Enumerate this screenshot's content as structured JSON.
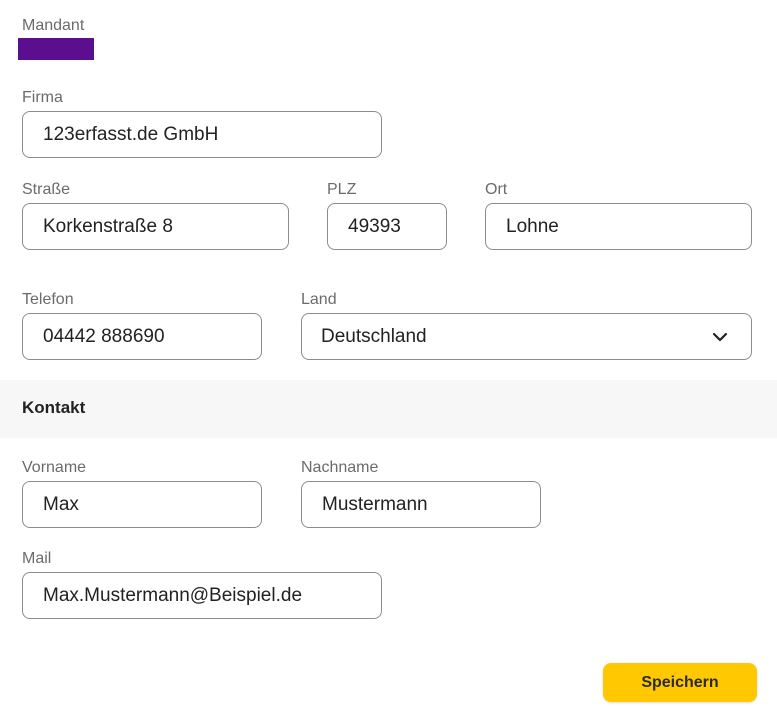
{
  "colors": {
    "mandant_swatch": "#5b0f8f",
    "save_button": "#ffc800",
    "section_band": "#f7f7f7"
  },
  "mandant": {
    "label": "Mandant"
  },
  "firma": {
    "label": "Firma",
    "value": "123erfasst.de GmbH"
  },
  "strasse": {
    "label": "Straße",
    "value": "Korkenstraße 8"
  },
  "plz": {
    "label": "PLZ",
    "value": "49393"
  },
  "ort": {
    "label": "Ort",
    "value": "Lohne"
  },
  "telefon": {
    "label": "Telefon",
    "value": "04442 888690"
  },
  "land": {
    "label": "Land",
    "value": "Deutschland",
    "icon": "chevron-down-icon"
  },
  "kontakt": {
    "section_title": "Kontakt",
    "vorname": {
      "label": "Vorname",
      "value": "Max"
    },
    "nachname": {
      "label": "Nachname",
      "value": "Mustermann"
    },
    "mail": {
      "label": "Mail",
      "value": "Max.Mustermann@Beispiel.de"
    }
  },
  "actions": {
    "save_label": "Speichern"
  }
}
